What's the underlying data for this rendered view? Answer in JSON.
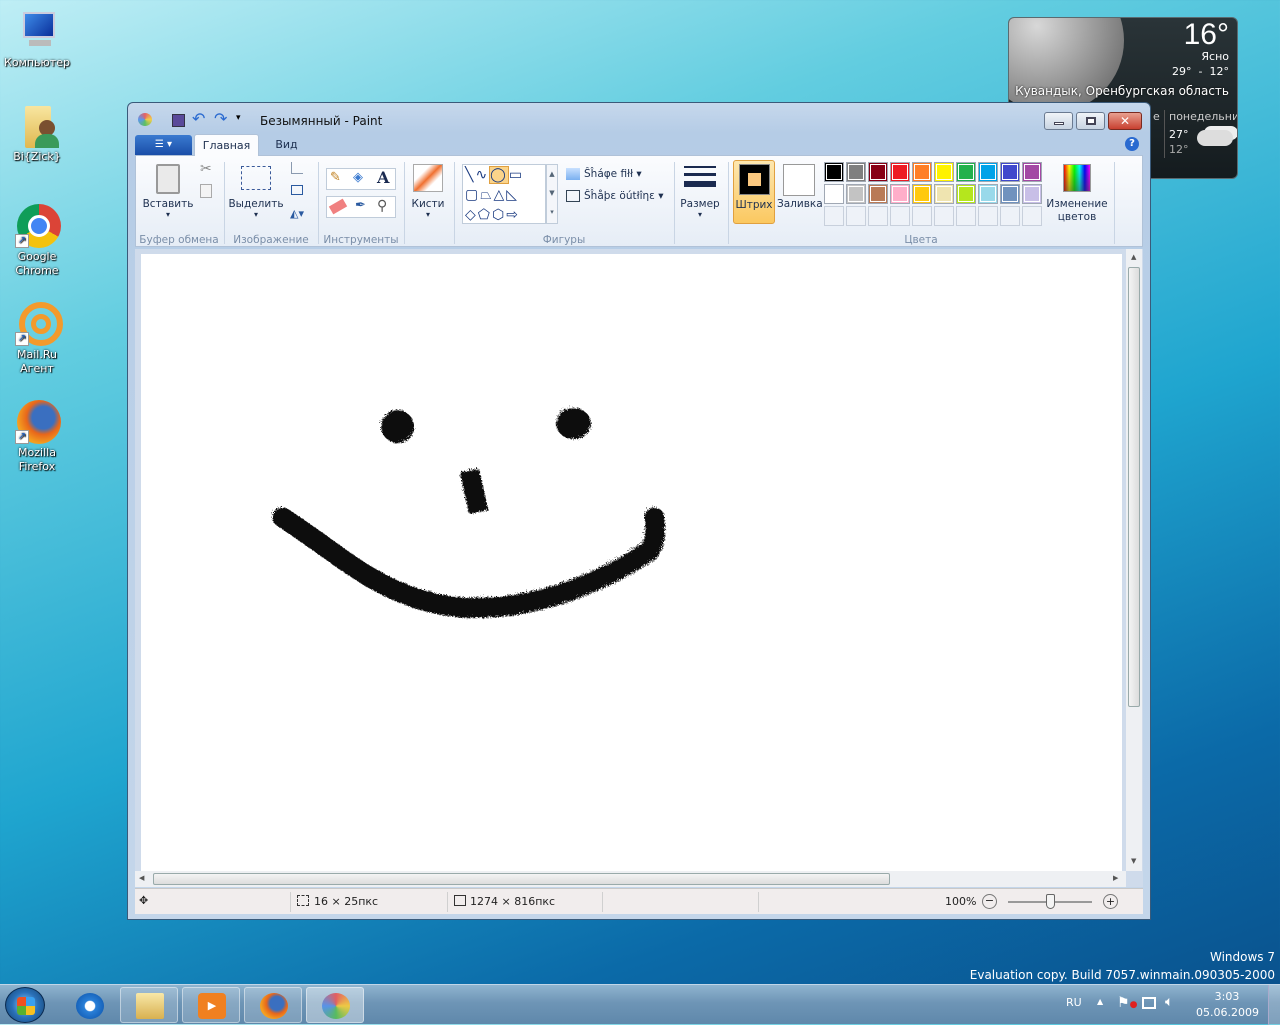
{
  "desktop": {
    "icons": [
      {
        "label": "Компьютер",
        "icon": "computer-icon"
      },
      {
        "label": "Bi{Zick}",
        "icon": "user-folder-icon"
      },
      {
        "label": "Google Chrome",
        "icon": "chrome-icon",
        "shortcut": true
      },
      {
        "label": "Mail.Ru Агент",
        "icon": "mailru-agent-icon",
        "shortcut": true
      },
      {
        "label": "Mozilla Firefox",
        "icon": "firefox-icon",
        "shortcut": true
      }
    ],
    "watermark": {
      "line1": "Windows 7",
      "line2": "Evaluation copy. Build 7057.winmain.090305-2000"
    }
  },
  "weather": {
    "temp": "16°",
    "condition": "Ясно",
    "range": "29°  -  12°",
    "location": "Кувандык, Оренбургская область",
    "forecast": [
      {
        "day": "е",
        "high": "",
        "low": ""
      },
      {
        "day": "понедельник",
        "high": "27°",
        "low": "12°"
      }
    ]
  },
  "window": {
    "title": "Безымянный - Paint",
    "tabs": [
      {
        "label": "Главная",
        "active": true
      },
      {
        "label": "Вид",
        "active": false
      }
    ],
    "ribbon": {
      "clipboard": {
        "group": "Буфер обмена",
        "paste": "Вставить"
      },
      "image": {
        "group": "Изображение",
        "select": "Выделить"
      },
      "tools": {
        "group": "Инструменты"
      },
      "brushes": {
        "label": "Кисти"
      },
      "shapes": {
        "group": "Фигуры",
        "fill": "Ŝĥáφe fiłł",
        "outline": "Ŝĥåþε öútłîηε"
      },
      "size": {
        "label": "Размер"
      },
      "color1": {
        "label": "Штрих",
        "color": "#000000"
      },
      "color2": {
        "label": "Заливка",
        "color": "#ffffff"
      },
      "colors": {
        "group": "Цвета",
        "palette": [
          [
            "#000000",
            "#7f7f7f",
            "#880015",
            "#ed1c24",
            "#ff7f27",
            "#fff200",
            "#22b14c",
            "#00a2e8",
            "#3f48cc",
            "#a349a4"
          ],
          [
            "#ffffff",
            "#c3c3c3",
            "#b97a57",
            "#ffaec9",
            "#ffc90e",
            "#efe4b0",
            "#b5e61d",
            "#99d9ea",
            "#7092be",
            "#c8bfe7"
          ]
        ]
      },
      "edit_colors": "Изменение цветов"
    },
    "status": {
      "selection": "16 × 25пкс",
      "image_size": "1274 × 816пкс",
      "zoom": "100%",
      "zoom_fraction": 0.5
    }
  },
  "taskbar": {
    "lang": "RU",
    "time": "3:03",
    "date": "05.06.2009",
    "items": [
      "internet-explorer-icon",
      "explorer-icon",
      "media-player-icon",
      "firefox-icon",
      "paint-icon"
    ]
  }
}
